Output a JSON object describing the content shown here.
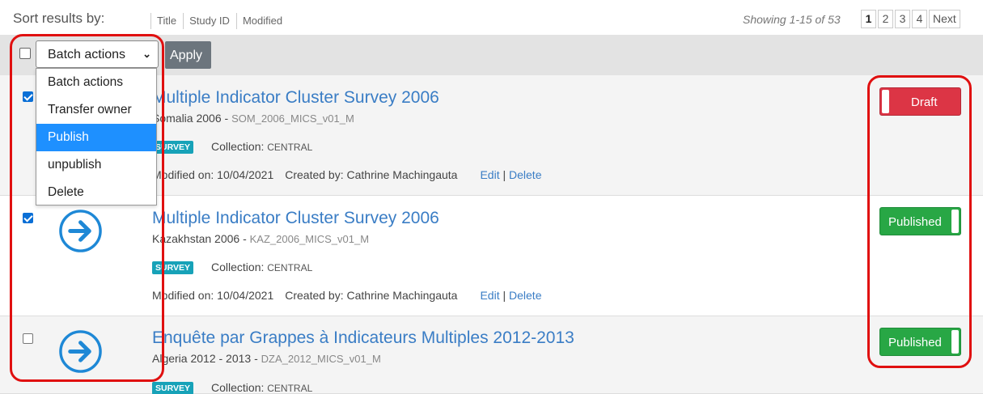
{
  "sort": {
    "label": "Sort results by:",
    "options": [
      "Title",
      "Study ID",
      "Modified"
    ]
  },
  "pagination": {
    "showing": "Showing 1-15 of 53",
    "pages": [
      "1",
      "2",
      "3",
      "4"
    ],
    "current": "1",
    "next": "Next"
  },
  "batch": {
    "selected": "Batch actions",
    "apply_label": "Apply",
    "options": [
      "Batch actions",
      "Transfer owner",
      "Publish",
      "unpublish",
      "Delete"
    ],
    "highlighted": "Publish"
  },
  "studies": [
    {
      "title": "Multiple Indicator Cluster Survey 2006",
      "country_year": "Somalia 2006 - ",
      "code": "SOM_2006_MICS_v01_M",
      "tag": "SURVEY",
      "collection_label": "Collection: ",
      "collection": "CENTRAL",
      "modified": "Modified on: 10/04/2021",
      "created": "Created by: Cathrine Machingauta",
      "edit": "Edit",
      "delete": "Delete",
      "status": "Draft",
      "checked": true
    },
    {
      "title": "Multiple Indicator Cluster Survey 2006",
      "country_year": "Kazakhstan 2006 - ",
      "code": "KAZ_2006_MICS_v01_M",
      "tag": "SURVEY",
      "collection_label": "Collection: ",
      "collection": "CENTRAL",
      "modified": "Modified on: 10/04/2021",
      "created": "Created by: Cathrine Machingauta",
      "edit": "Edit",
      "delete": "Delete",
      "status": "Published",
      "checked": true
    },
    {
      "title": "Enquête par Grappes à Indicateurs Multiples 2012-2013",
      "country_year": "Algeria 2012 - 2013 - ",
      "code": "DZA_2012_MICS_v01_M",
      "tag": "SURVEY",
      "collection_label": "Collection: ",
      "collection": "CENTRAL",
      "status": "Published",
      "checked": false
    }
  ],
  "colors": {
    "link": "#3a7dc5",
    "draft": "#dc3545",
    "published": "#28a745",
    "highlight": "#e01010",
    "dropdown_selected": "#1e90ff"
  },
  "icons": {
    "row_action": "arrow-right-circle-icon",
    "select_caret": "chevron-down-icon"
  }
}
